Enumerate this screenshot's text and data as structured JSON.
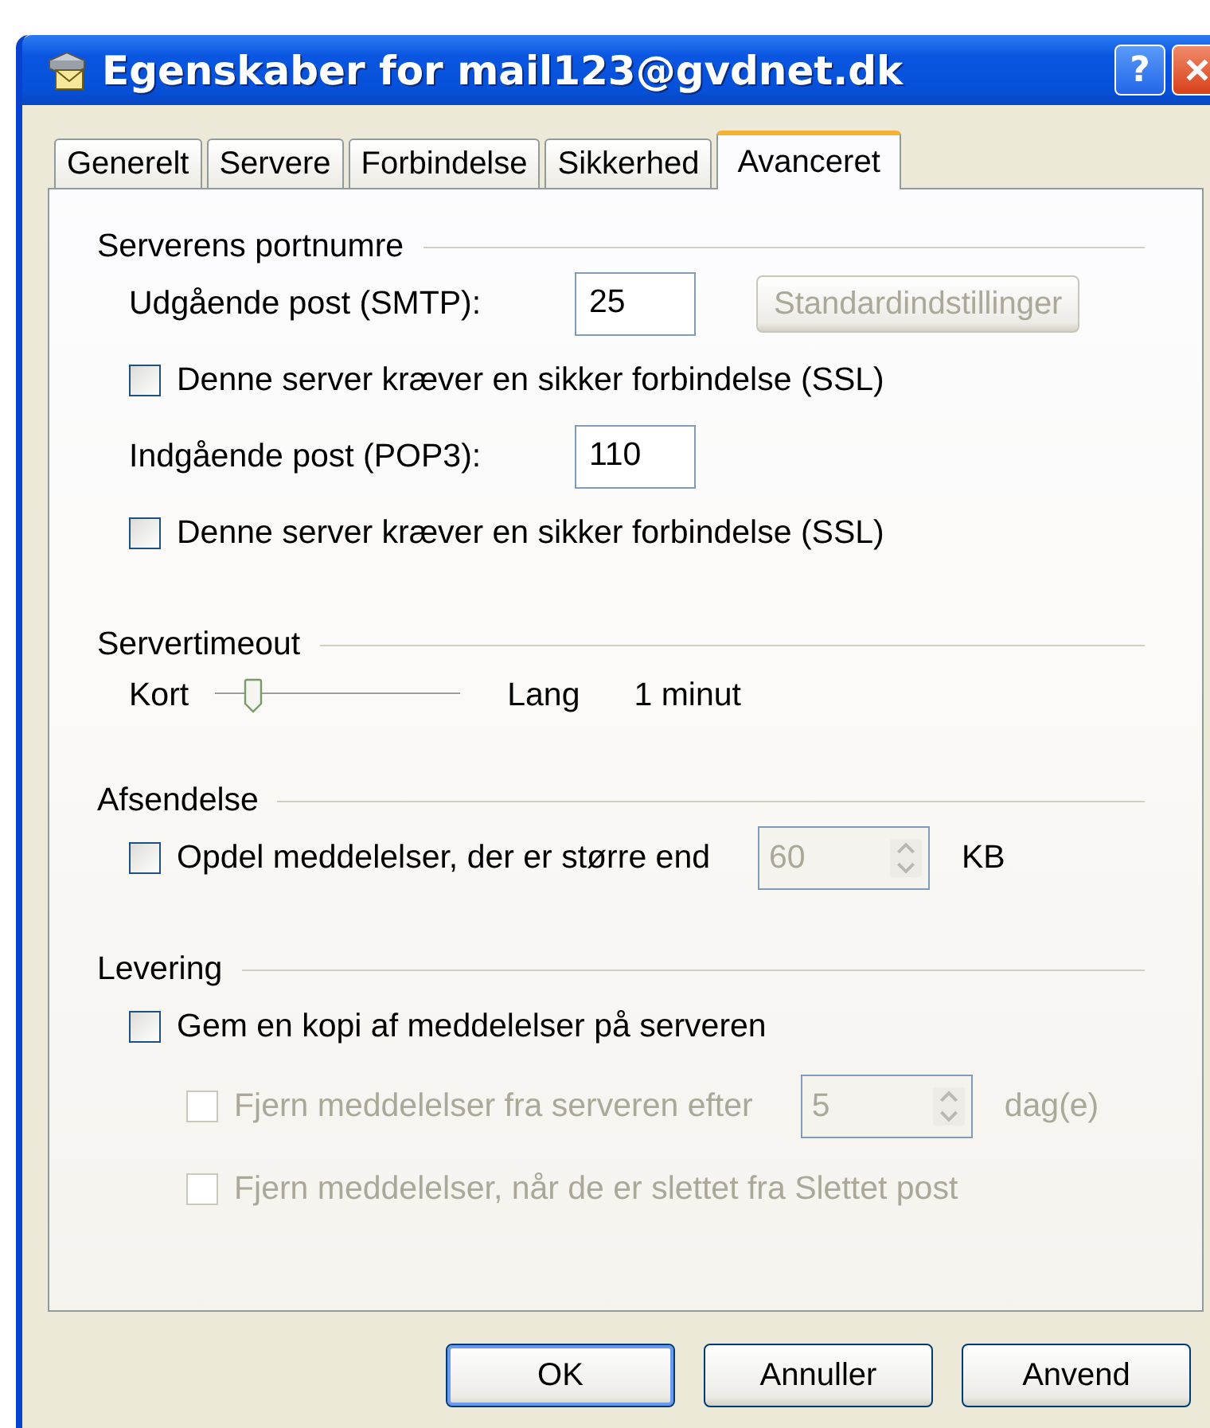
{
  "window": {
    "title": "Egenskaber for mail123@gvdnet.dk",
    "help": "?"
  },
  "tabs": [
    {
      "label": "Generelt",
      "selected": false
    },
    {
      "label": "Servere",
      "selected": false
    },
    {
      "label": "Forbindelse",
      "selected": false
    },
    {
      "label": "Sikkerhed",
      "selected": false
    },
    {
      "label": "Avanceret",
      "selected": true
    }
  ],
  "sections": [
    {
      "heading": "Serverens portnumre",
      "rows": [
        {
          "kind": "field",
          "label": "Udgående post (SMTP):",
          "value": "25",
          "button": {
            "label": "Standardindstillinger",
            "disabled": true
          }
        },
        {
          "kind": "checkbox",
          "label": "Denne server kræver en sikker forbindelse (SSL)",
          "checked": false,
          "disabled": false
        },
        {
          "kind": "field",
          "label": "Indgående post (POP3):",
          "value": "110"
        },
        {
          "kind": "checkbox",
          "label": "Denne server kræver en sikker forbindelse (SSL)",
          "checked": false,
          "disabled": false
        }
      ]
    },
    {
      "heading": "Servertimeout",
      "rows": [
        {
          "kind": "slider",
          "min_label": "Kort",
          "max_label": "Lang",
          "level": 0.12,
          "reading": "1 minut"
        }
      ]
    },
    {
      "heading": "Afsendelse",
      "rows": [
        {
          "kind": "checkbox_spin",
          "label": "Opdel meddelelser, der er større end",
          "checked": false,
          "disabled": false,
          "spin": {
            "value": "60",
            "disabled": true
          },
          "unit": "KB"
        }
      ]
    },
    {
      "heading": "Levering",
      "rows": [
        {
          "kind": "checkbox",
          "label": "Gem en kopi af meddelelser på serveren",
          "checked": false,
          "disabled": false,
          "children": [
            {
              "kind": "checkbox_spin",
              "label": "Fjern meddelelser fra serveren efter",
              "checked": false,
              "disabled": true,
              "spin": {
                "value": "5",
                "disabled": true
              },
              "unit": "dag(e)"
            },
            {
              "kind": "checkbox",
              "label": "Fjern meddelelser, når de er slettet fra Slettet post",
              "checked": false,
              "disabled": true
            }
          ]
        }
      ]
    }
  ],
  "buttons": [
    {
      "label": "OK",
      "default": true
    },
    {
      "label": "Annuller",
      "default": false
    },
    {
      "label": "Anvend",
      "default": false
    }
  ]
}
